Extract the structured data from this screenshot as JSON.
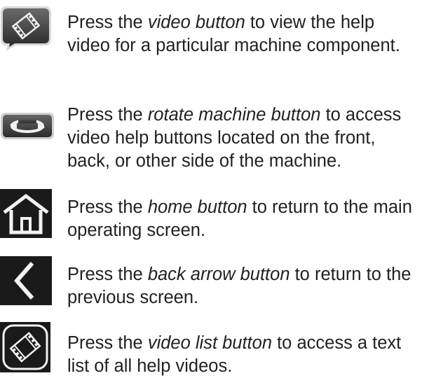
{
  "items": [
    {
      "icon": "video-button-icon",
      "pre": "Press the ",
      "term": "video button",
      "post": " to view the help video for a particular machine component."
    },
    {
      "icon": "rotate-machine-icon",
      "pre": "Press the ",
      "term": "rotate machine button",
      "post": " to access video help buttons located on the front, back, or other side of the machine."
    },
    {
      "icon": "home-icon",
      "pre": "Press the ",
      "term": "home button",
      "post": " to return to the main operating screen."
    },
    {
      "icon": "back-arrow-icon",
      "pre": "Press the ",
      "term": "back arrow button",
      "post": " to return to the previous screen."
    },
    {
      "icon": "video-list-icon",
      "pre": "Press the ",
      "term": "video list button",
      "post": " to access a text list of all help videos."
    }
  ],
  "colors": {
    "text": "#231f20",
    "icon_dark": "#1a1a1a",
    "icon_mid": "#4a4a4a",
    "icon_light": "#f2f2f2"
  }
}
